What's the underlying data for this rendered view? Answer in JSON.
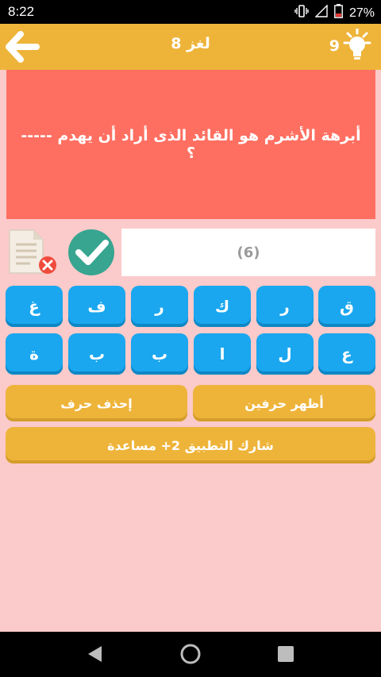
{
  "status": {
    "time": "8:22",
    "battery": "27%"
  },
  "header": {
    "title": "لغز 8",
    "hint_count": "9"
  },
  "question": {
    "text": "أبرهة الأشرم هو القائد الذى أراد أن يهدم ----- ؟"
  },
  "answer": {
    "placeholder": "(6)"
  },
  "keyboard": {
    "row1": [
      "غ",
      "ف",
      "ر",
      "ك",
      "ر",
      "ق"
    ],
    "row2": [
      "ة",
      "ب",
      "ب",
      "ا",
      "ل",
      "ع"
    ]
  },
  "actions": {
    "delete_letter": "إحذف حرف",
    "reveal_two": "أظهر حرفين",
    "share_help": "شارك التطبيق 2+ مساعدة"
  },
  "colors": {
    "accent": "#eeb43a",
    "question_bg": "#ff6f61",
    "key_bg": "#1aa7ef",
    "page_bg": "#fbcaca"
  }
}
